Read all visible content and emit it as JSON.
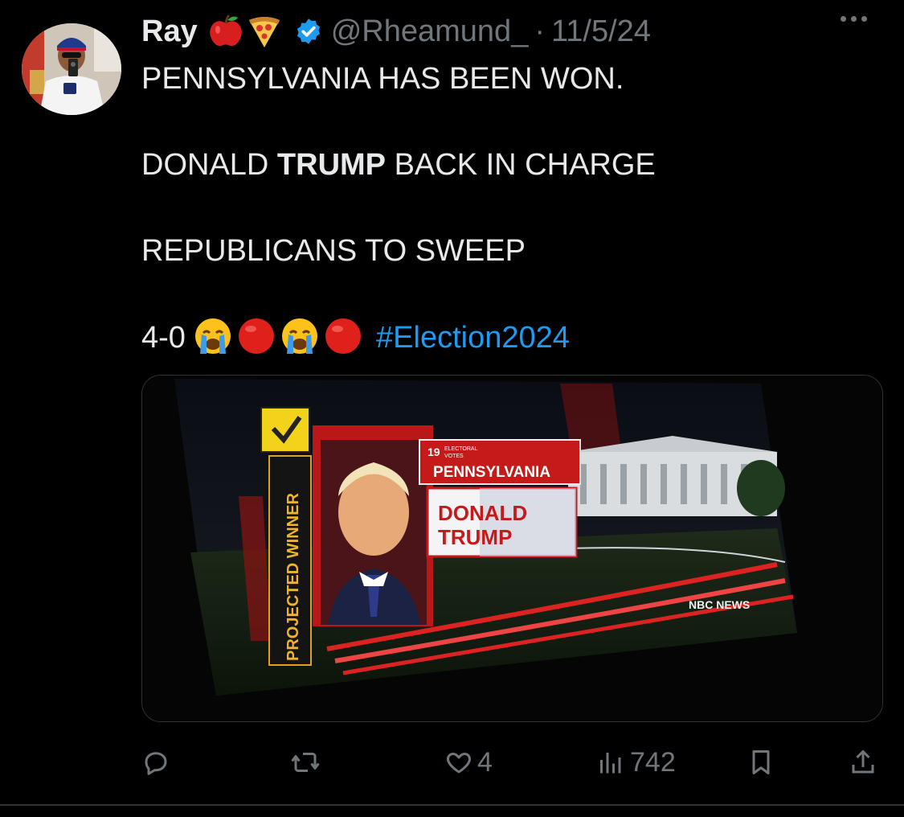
{
  "tweet": {
    "author_name": "Ray",
    "author_handle": "@Rheamund_",
    "separator": "·",
    "date": "11/5/24",
    "name_emojis": [
      "apple-icon",
      "pizza-icon"
    ],
    "verified": true,
    "lines": {
      "line1": "PENNSYLVANIA HAS BEEN WON.",
      "line2_a": "DONALD ",
      "line2_b": "TRUMP",
      "line2_c": " BACK IN CHARGE",
      "line3": "REPUBLICANS TO SWEEP",
      "line4_score": "4-0",
      "hashtag": "#Election2024"
    },
    "line4_emojis": [
      "crying-face-icon",
      "red-circle-icon",
      "crying-face-icon",
      "red-circle-icon"
    ]
  },
  "media": {
    "electoral_votes": "19",
    "electoral_label_top": "ELECTORAL",
    "electoral_label_bottom": "VOTES",
    "state": "PENNSYLVANIA",
    "candidate_first": "DONALD",
    "candidate_last": "TRUMP",
    "banner": "PROJECTED WINNER",
    "network": "NBC NEWS"
  },
  "actions": {
    "replies": "",
    "reposts": "",
    "likes": "4",
    "views": "742"
  },
  "colors": {
    "background": "#000000",
    "text": "#e7e9ea",
    "muted": "#71767b",
    "link": "#1d9bf0",
    "verified": "#1d9bf0",
    "divider": "#2f3336"
  }
}
